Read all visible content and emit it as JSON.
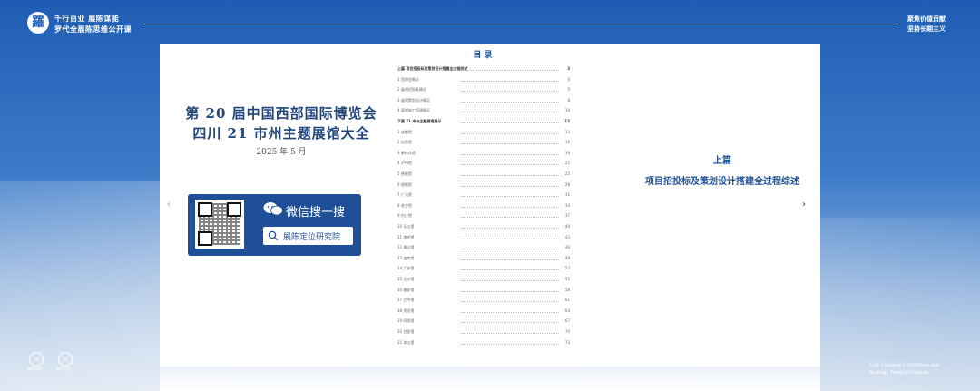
{
  "header": {
    "logo_char": "羅",
    "slogan_line1": "千行百业  展陈谋能",
    "slogan_line2": "罗代全展陈思维公开课",
    "right_line1": "聚焦价值贡献",
    "right_line2": "坚持长期主义"
  },
  "cover": {
    "title_line1": "第 20 届中国西部国际博览会",
    "title_line2": "四川 21 市州主题展馆大全",
    "date": "2025 年 5 月"
  },
  "wechat": {
    "label": "微信搜一搜",
    "search_text": "展陈定位研究院"
  },
  "toc": {
    "title": "目 录",
    "items": [
      {
        "text": "上篇  项目招投标及策划设计搭建全过程综述",
        "page": "3",
        "sec": true
      },
      {
        "text": "1  西博会概况",
        "page": "4",
        "sec": false
      },
      {
        "text": "2  展馆招投标情况",
        "page": "5",
        "sec": false
      },
      {
        "text": "3  展馆策划设计情况",
        "page": "8",
        "sec": false
      },
      {
        "text": "4  展馆施工搭建情况",
        "page": "10",
        "sec": false
      },
      {
        "text": "下篇  21 市州主题展馆展示",
        "page": "12",
        "sec": true
      },
      {
        "text": "1  成都馆",
        "page": "13",
        "sec": false
      },
      {
        "text": "2  自贡馆",
        "page": "16",
        "sec": false
      },
      {
        "text": "3  攀枝花馆",
        "page": "19",
        "sec": false
      },
      {
        "text": "4  泸州馆",
        "page": "22",
        "sec": false
      },
      {
        "text": "5  德阳馆",
        "page": "25",
        "sec": false
      },
      {
        "text": "6  绵阳馆",
        "page": "28",
        "sec": false
      },
      {
        "text": "7  广元馆",
        "page": "31",
        "sec": false
      },
      {
        "text": "8  遂宁馆",
        "page": "34",
        "sec": false
      },
      {
        "text": "9  内江馆",
        "page": "37",
        "sec": false
      },
      {
        "text": "10  乐山馆",
        "page": "40",
        "sec": false
      },
      {
        "text": "11  南充馆",
        "page": "43",
        "sec": false
      },
      {
        "text": "12  眉山馆",
        "page": "46",
        "sec": false
      },
      {
        "text": "13  宜宾馆",
        "page": "49",
        "sec": false
      },
      {
        "text": "14  广安馆",
        "page": "52",
        "sec": false
      },
      {
        "text": "15  达州馆",
        "page": "55",
        "sec": false
      },
      {
        "text": "16  雅安馆",
        "page": "58",
        "sec": false
      },
      {
        "text": "17  巴中馆",
        "page": "61",
        "sec": false
      },
      {
        "text": "18  资阳馆",
        "page": "64",
        "sec": false
      },
      {
        "text": "19  阿坝馆",
        "page": "67",
        "sec": false
      },
      {
        "text": "20  甘孜馆",
        "page": "70",
        "sec": false
      },
      {
        "text": "21  凉山馆",
        "page": "73",
        "sec": false
      }
    ]
  },
  "right_page": {
    "heading": "上篇",
    "subtitle": "项目招投标及策划设计搭建全过程综述"
  },
  "footer": {
    "badge1_label": "展陈谋能",
    "badge2_label": "展陈定位",
    "en_line1": "Cost Category's Exhibition and",
    "en_line2": "Strategy Training Institute"
  },
  "colors": {
    "brand": "#1e4f97",
    "accent": "#23467a"
  }
}
